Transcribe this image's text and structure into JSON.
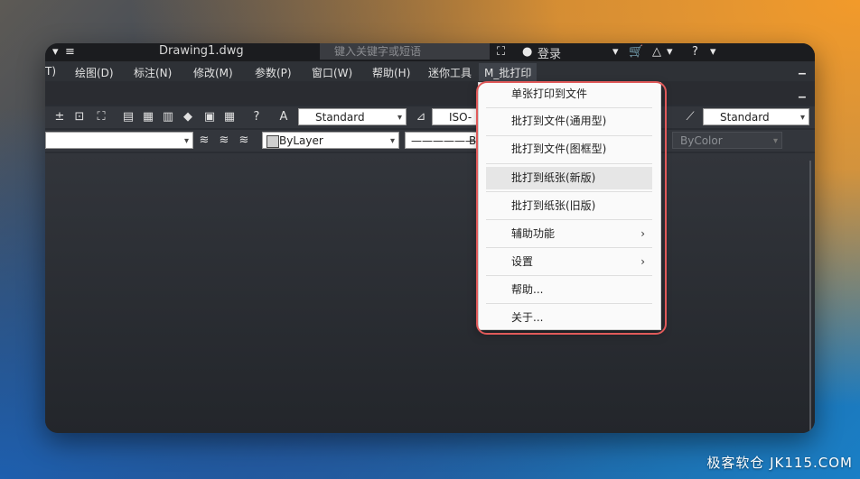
{
  "title_bar": {
    "document_name": "Drawing1.dwg",
    "search_placeholder": "键入关键字或短语",
    "login_label": "登录",
    "icons": [
      "quick-access-menu-icon",
      "binoculars-icon",
      "user-icon",
      "cart-icon",
      "a360-icon",
      "help-icon"
    ]
  },
  "menu_bar": {
    "items": [
      {
        "label": "T)"
      },
      {
        "label": "绘图(D)"
      },
      {
        "label": "标注(N)"
      },
      {
        "label": "修改(M)"
      },
      {
        "label": "参数(P)"
      },
      {
        "label": "窗口(W)"
      },
      {
        "label": "帮助(H)"
      },
      {
        "label": "迷你工具"
      },
      {
        "label": "M_批打印"
      }
    ],
    "active_index": 8
  },
  "toolbar1": {
    "text_style": "Standard",
    "dim_style": "ISO-2",
    "table_style": "Standard"
  },
  "toolbar2": {
    "layer_color": "ByLayer",
    "linetype": "B",
    "plot_color": "ByColor"
  },
  "dropdown_menu": {
    "items": [
      {
        "label": "单张打印到文件",
        "submenu": false
      },
      {
        "label": "批打到文件(通用型)",
        "submenu": false
      },
      {
        "label": "批打到文件(图框型)",
        "submenu": false
      },
      {
        "label": "批打到纸张(新版)",
        "submenu": false,
        "hovered": true
      },
      {
        "label": "批打到纸张(旧版)",
        "submenu": false
      },
      {
        "label": "辅助功能",
        "submenu": true
      },
      {
        "label": "设置",
        "submenu": true
      },
      {
        "label": "帮助...",
        "submenu": false
      },
      {
        "label": "关于...",
        "submenu": false
      }
    ],
    "submenu_arrow": "›"
  },
  "watermark": "极客软仓 JK115.COM",
  "colors": {
    "highlight_ring": "#e05a5a",
    "menu_bg": "#fafafa",
    "app_bg": "#2a2d33"
  }
}
